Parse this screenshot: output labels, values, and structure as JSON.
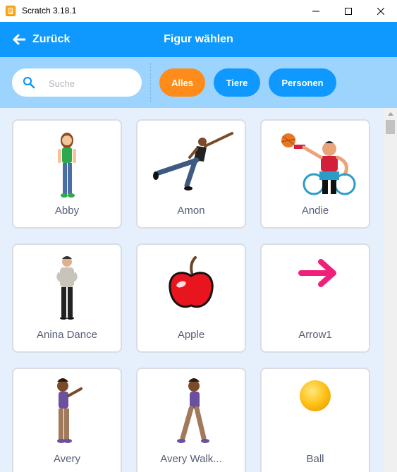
{
  "window": {
    "title": "Scratch 3.18.1"
  },
  "header": {
    "back_label": "Zurück",
    "title": "Figur wählen"
  },
  "search": {
    "placeholder": "Suche"
  },
  "tags": [
    {
      "label": "Alles",
      "selected": true
    },
    {
      "label": "Tiere",
      "selected": false
    },
    {
      "label": "Personen",
      "selected": false
    }
  ],
  "sprites": [
    {
      "name": "Abby"
    },
    {
      "name": "Amon"
    },
    {
      "name": "Andie"
    },
    {
      "name": "Anina Dance"
    },
    {
      "name": "Apple"
    },
    {
      "name": "Arrow1"
    },
    {
      "name": "Avery"
    },
    {
      "name": "Avery Walk..."
    },
    {
      "name": "Ball"
    }
  ],
  "colors": {
    "menu_bar": "#0f98fd",
    "filter_bar": "#9cd4fd",
    "selected_tag": "#ff8c1a",
    "content_bg": "#e6f0fc"
  }
}
